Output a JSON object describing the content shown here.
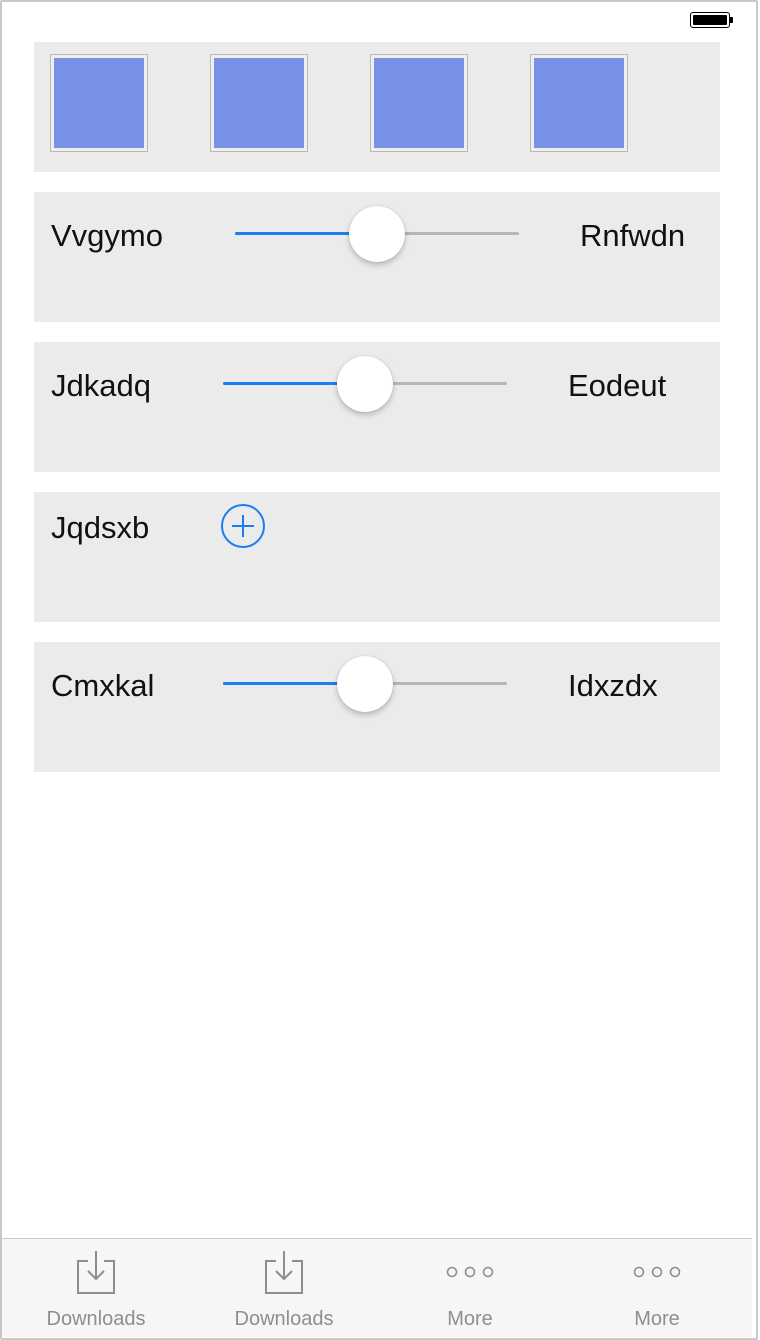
{
  "status_bar": {
    "battery_icon": "battery-full-icon"
  },
  "swatches": [
    {
      "color": "#7891e5"
    },
    {
      "color": "#7891e5"
    },
    {
      "color": "#7891e5"
    },
    {
      "color": "#7891e5"
    }
  ],
  "rows": [
    {
      "type": "slider",
      "left_label": "Vvgymo",
      "right_label": "Rnfwdn",
      "value": 0.5
    },
    {
      "type": "slider",
      "left_label": "Jdkadq",
      "right_label": "Eodeut",
      "value": 0.5
    },
    {
      "type": "add",
      "label": "Jqdsxb",
      "icon": "plus-circle-icon"
    },
    {
      "type": "slider",
      "left_label": "Cmxkal",
      "right_label": "Idxzdx",
      "value": 0.5
    }
  ],
  "accent_color": "#1a7ef1",
  "tabs": [
    {
      "label": "Downloads",
      "icon": "downloads-icon"
    },
    {
      "label": "Downloads",
      "icon": "downloads-icon"
    },
    {
      "label": "More",
      "icon": "more-icon"
    },
    {
      "label": "More",
      "icon": "more-icon"
    }
  ]
}
